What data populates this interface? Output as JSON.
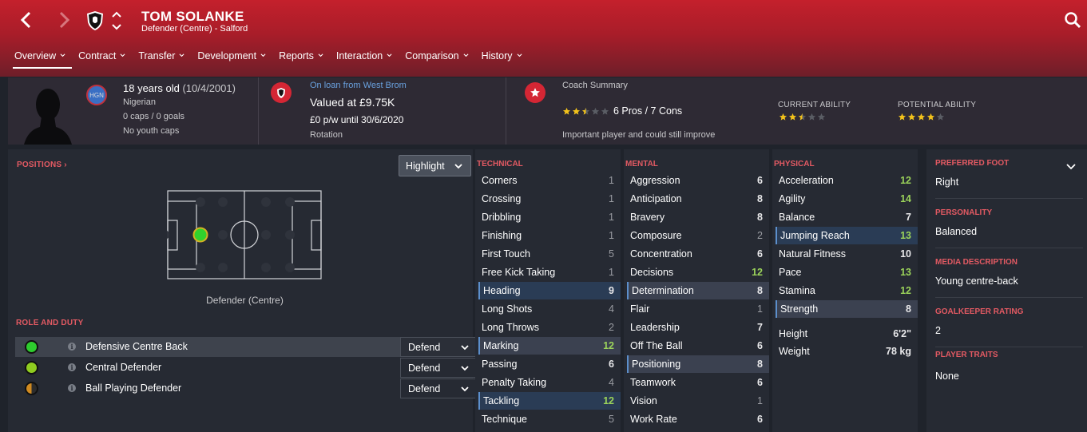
{
  "header": {
    "player_name": "TOM SOLANKE",
    "player_sub": "Defender (Centre) - Salford",
    "tabs": [
      {
        "label": "Overview"
      },
      {
        "label": "Contract"
      },
      {
        "label": "Transfer"
      },
      {
        "label": "Development"
      },
      {
        "label": "Reports"
      },
      {
        "label": "Interaction"
      },
      {
        "label": "Comparison"
      },
      {
        "label": "History"
      }
    ]
  },
  "summary": {
    "nation_code": "HGN",
    "age": "18 years old",
    "dob": "(10/4/2001)",
    "nationality": "Nigerian",
    "caps": "0 caps / 0 goals",
    "youth_caps": "No youth caps",
    "loan": "On loan from West Brom",
    "value": "Valued at £9.75K",
    "wage": "£0 p/w until 30/6/2020",
    "squad_status": "Rotation",
    "coach_summary_label": "Coach Summary",
    "pros_cons": "6 Pros / 7 Cons",
    "coach_comment": "Important player and could still improve",
    "coach_stars": 2.5,
    "current_ability_label": "CURRENT ABILITY",
    "current_ability_stars": 2.5,
    "potential_ability_label": "POTENTIAL ABILITY",
    "potential_ability_stars": 4
  },
  "positions": {
    "title": "POSITIONS",
    "highlight_label": "Highlight",
    "caption": "Defender (Centre)",
    "role_title": "ROLE AND DUTY",
    "roles": [
      {
        "name": "Defensive Centre Back",
        "duty": "Defend",
        "color": "#2ecc2e"
      },
      {
        "name": "Central Defender",
        "duty": "Defend",
        "color": "#8fcc20"
      },
      {
        "name": "Ball Playing Defender",
        "duty": "Defend",
        "color": "#d08a20"
      }
    ]
  },
  "attributes": {
    "technical": {
      "title": "TECHNICAL",
      "items": [
        {
          "name": "Corners",
          "value": 1
        },
        {
          "name": "Crossing",
          "value": 1
        },
        {
          "name": "Dribbling",
          "value": 1
        },
        {
          "name": "Finishing",
          "value": 1
        },
        {
          "name": "First Touch",
          "value": 5
        },
        {
          "name": "Free Kick Taking",
          "value": 1
        },
        {
          "name": "Heading",
          "value": 9
        },
        {
          "name": "Long Shots",
          "value": 4
        },
        {
          "name": "Long Throws",
          "value": 2
        },
        {
          "name": "Marking",
          "value": 12
        },
        {
          "name": "Passing",
          "value": 6
        },
        {
          "name": "Penalty Taking",
          "value": 4
        },
        {
          "name": "Tackling",
          "value": 12
        },
        {
          "name": "Technique",
          "value": 5
        }
      ]
    },
    "mental": {
      "title": "MENTAL",
      "items": [
        {
          "name": "Aggression",
          "value": 6
        },
        {
          "name": "Anticipation",
          "value": 8
        },
        {
          "name": "Bravery",
          "value": 8
        },
        {
          "name": "Composure",
          "value": 2
        },
        {
          "name": "Concentration",
          "value": 6
        },
        {
          "name": "Decisions",
          "value": 12
        },
        {
          "name": "Determination",
          "value": 8
        },
        {
          "name": "Flair",
          "value": 1
        },
        {
          "name": "Leadership",
          "value": 7
        },
        {
          "name": "Off The Ball",
          "value": 6
        },
        {
          "name": "Positioning",
          "value": 8
        },
        {
          "name": "Teamwork",
          "value": 6
        },
        {
          "name": "Vision",
          "value": 1
        },
        {
          "name": "Work Rate",
          "value": 6
        }
      ]
    },
    "physical": {
      "title": "PHYSICAL",
      "items": [
        {
          "name": "Acceleration",
          "value": 12
        },
        {
          "name": "Agility",
          "value": 14
        },
        {
          "name": "Balance",
          "value": 7
        },
        {
          "name": "Jumping Reach",
          "value": 13
        },
        {
          "name": "Natural Fitness",
          "value": 10
        },
        {
          "name": "Pace",
          "value": 13
        },
        {
          "name": "Stamina",
          "value": 12
        },
        {
          "name": "Strength",
          "value": 8
        }
      ],
      "height_label": "Height",
      "height": "6'2\"",
      "weight_label": "Weight",
      "weight": "78 kg"
    }
  },
  "info": {
    "preferred_foot_label": "PREFERRED FOOT",
    "preferred_foot": "Right",
    "personality_label": "PERSONALITY",
    "personality": "Balanced",
    "media_label": "MEDIA DESCRIPTION",
    "media": "Young centre-back",
    "gk_label": "GOALKEEPER RATING",
    "gk": "2",
    "traits_label": "PLAYER TRAITS",
    "traits": "None"
  },
  "colors": {
    "header_red": "#c4202c",
    "accent_red": "#e35a63",
    "good_green": "#9bd35a",
    "star_gold": "#f2c21b",
    "loan_blue": "#6aa2e0"
  }
}
